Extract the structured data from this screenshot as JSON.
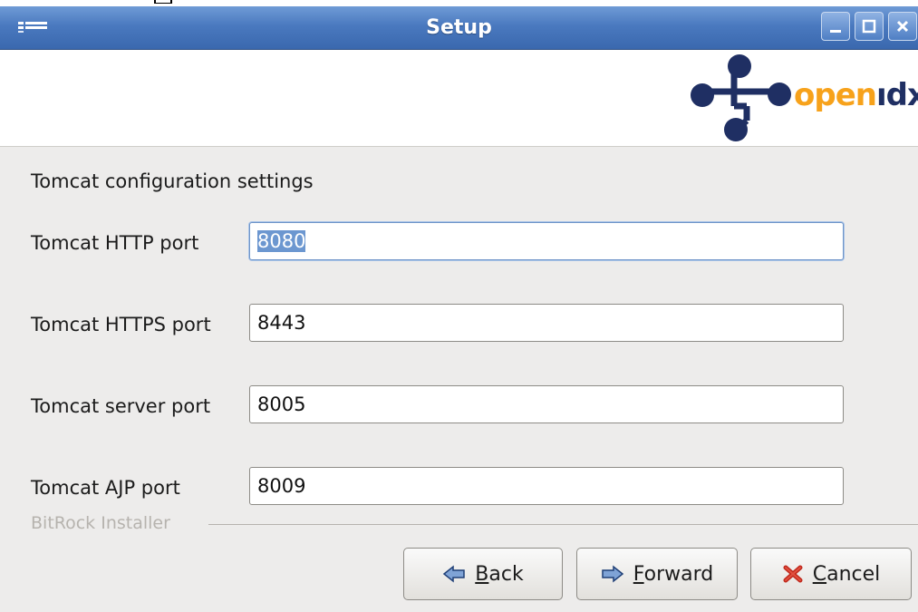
{
  "window": {
    "title": "Setup"
  },
  "window_controls": {
    "minimize_icon": "minimize-icon",
    "maximize_icon": "maximize-icon",
    "close_icon": "close-icon"
  },
  "header": {
    "logo_text_open": "open",
    "logo_text_dx": "ıdx"
  },
  "form": {
    "section_title": "Tomcat configuration settings",
    "fields": [
      {
        "label": "Tomcat HTTP port",
        "value": "8080"
      },
      {
        "label": "Tomcat HTTPS port",
        "value": "8443"
      },
      {
        "label": "Tomcat server port",
        "value": "8005"
      },
      {
        "label": "Tomcat AJP port",
        "value": "8009"
      }
    ]
  },
  "footer": {
    "installer_label": "BitRock Installer"
  },
  "buttons": {
    "back_mnemonic": "B",
    "back_rest": "ack",
    "forward_mnemonic": "F",
    "forward_rest": "orward",
    "cancel_mnemonic": "C",
    "cancel_rest": "ancel"
  },
  "colors": {
    "titlebar": "#4a79bf",
    "logo_orange": "#f7a21b",
    "logo_navy": "#1f2f63",
    "selection": "#6c97d0"
  }
}
